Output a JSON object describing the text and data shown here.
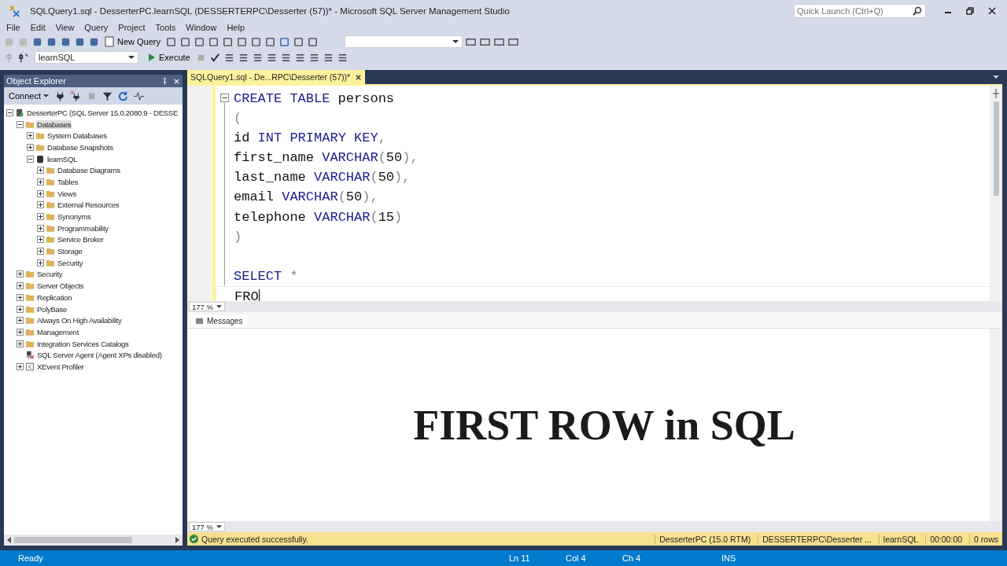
{
  "window": {
    "title": "SQLQuery1.sql - DesserterPC.learnSQL (DESSERTERPC\\Desserter (57))* - Microsoft SQL Server Management Studio",
    "quick_launch": {
      "placeholder": "Quick Launch (Ctrl+Q)"
    }
  },
  "menu": [
    "File",
    "Edit",
    "View",
    "Query",
    "Project",
    "Tools",
    "Window",
    "Help"
  ],
  "toolbar": {
    "new_query": "New Query",
    "execute": "Execute",
    "database": "learnSQL"
  },
  "object_explorer": {
    "title": "Object Explorer",
    "connect": "Connect",
    "tree": [
      {
        "label": "DesserterPC (SQL Server 15.0.2080.9 - DESSE",
        "kind": "server",
        "expanded": true,
        "selected": false,
        "children": [
          {
            "label": "Databases",
            "kind": "folder",
            "expanded": true,
            "selected": true,
            "children": [
              {
                "label": "System Databases",
                "kind": "folder",
                "expanded": false,
                "selected": false
              },
              {
                "label": "Database Snapshots",
                "kind": "folder",
                "expanded": false,
                "selected": false
              },
              {
                "label": "learnSQL",
                "kind": "database",
                "expanded": true,
                "selected": false,
                "children": [
                  {
                    "label": "Database Diagrams",
                    "kind": "folder",
                    "expanded": false,
                    "selected": false
                  },
                  {
                    "label": "Tables",
                    "kind": "folder",
                    "expanded": false,
                    "selected": false
                  },
                  {
                    "label": "Views",
                    "kind": "folder",
                    "expanded": false,
                    "selected": false
                  },
                  {
                    "label": "External Resources",
                    "kind": "folder",
                    "expanded": false,
                    "selected": false
                  },
                  {
                    "label": "Synonyms",
                    "kind": "folder",
                    "expanded": false,
                    "selected": false
                  },
                  {
                    "label": "Programmability",
                    "kind": "folder",
                    "expanded": false,
                    "selected": false
                  },
                  {
                    "label": "Service Broker",
                    "kind": "folder",
                    "expanded": false,
                    "selected": false
                  },
                  {
                    "label": "Storage",
                    "kind": "folder",
                    "expanded": false,
                    "selected": false
                  },
                  {
                    "label": "Security",
                    "kind": "folder",
                    "expanded": false,
                    "selected": false
                  }
                ]
              }
            ]
          },
          {
            "label": "Security",
            "kind": "folder",
            "expanded": false,
            "selected": false
          },
          {
            "label": "Server Objects",
            "kind": "folder",
            "expanded": false,
            "selected": false
          },
          {
            "label": "Replication",
            "kind": "folder",
            "expanded": false,
            "selected": false
          },
          {
            "label": "PolyBase",
            "kind": "folder",
            "expanded": false,
            "selected": false
          },
          {
            "label": "Always On High Availability",
            "kind": "folder",
            "expanded": false,
            "selected": false
          },
          {
            "label": "Management",
            "kind": "folder",
            "expanded": false,
            "selected": false
          },
          {
            "label": "Integration Services Catalogs",
            "kind": "folder",
            "expanded": false,
            "selected": false
          },
          {
            "label": "SQL Server Agent (Agent XPs disabled)",
            "kind": "agent",
            "selected": false
          },
          {
            "label": "XEvent Profiler",
            "kind": "xevent",
            "expanded": false,
            "selected": false
          }
        ]
      }
    ]
  },
  "editor": {
    "tab": {
      "label": "SQLQuery1.sql - De...RPC\\Desserter (57))*",
      "selected": true
    },
    "blocks": [
      {
        "lines": [
          {
            "tokens": [
              {
                "text": "CREATE TABLE",
                "kind": "keyword"
              },
              {
                "text": " persons",
                "kind": "plain"
              }
            ]
          },
          {
            "tokens": [
              {
                "text": "(",
                "kind": "punct"
              }
            ]
          },
          {
            "tokens": [
              {
                "text": "id ",
                "kind": "plain"
              },
              {
                "text": "INT PRIMARY KEY",
                "kind": "keyword"
              },
              {
                "text": ",",
                "kind": "punct"
              }
            ]
          },
          {
            "tokens": [
              {
                "text": "first_name ",
                "kind": "plain"
              },
              {
                "text": "VARCHAR",
                "kind": "keyword"
              },
              {
                "text": "(",
                "kind": "punct"
              },
              {
                "text": "50",
                "kind": "plain"
              },
              {
                "text": "),",
                "kind": "punct"
              }
            ]
          },
          {
            "tokens": [
              {
                "text": "last_name ",
                "kind": "plain"
              },
              {
                "text": "VARCHAR",
                "kind": "keyword"
              },
              {
                "text": "(",
                "kind": "punct"
              },
              {
                "text": "50",
                "kind": "plain"
              },
              {
                "text": "),",
                "kind": "punct"
              }
            ]
          },
          {
            "tokens": [
              {
                "text": "email ",
                "kind": "plain"
              },
              {
                "text": "VARCHAR",
                "kind": "keyword"
              },
              {
                "text": "(",
                "kind": "punct"
              },
              {
                "text": "50",
                "kind": "plain"
              },
              {
                "text": "),",
                "kind": "punct"
              }
            ]
          },
          {
            "tokens": [
              {
                "text": "telephone ",
                "kind": "plain"
              },
              {
                "text": "VARCHAR",
                "kind": "keyword"
              },
              {
                "text": "(",
                "kind": "punct"
              },
              {
                "text": "15",
                "kind": "plain"
              },
              {
                "text": ")",
                "kind": "punct"
              }
            ]
          },
          {
            "tokens": [
              {
                "text": ")",
                "kind": "punct"
              }
            ]
          }
        ]
      },
      {
        "lines": [
          {
            "tokens": [
              {
                "text": "SELECT",
                "kind": "keyword"
              },
              {
                "text": " *",
                "kind": "punct"
              }
            ]
          },
          {
            "tokens": [
              {
                "text": "FRO",
                "kind": "plain"
              }
            ]
          }
        ]
      }
    ],
    "zoom": "177 %"
  },
  "results": {
    "tab": "Messages",
    "caption": "FIRST ROW in SQL",
    "zoom": "177 %",
    "status": {
      "message": "Query executed successfully.",
      "server": "DesserterPC (15.0 RTM)",
      "user": "DESSERTERPC\\Desserter ...",
      "database": "learnSQL",
      "time": "00:00:00",
      "rows": "0 rows"
    }
  },
  "status_bar": {
    "state": "Ready",
    "line": "Ln 11",
    "col": "Col 4",
    "ch": "Ch 4",
    "mode": "INS"
  }
}
